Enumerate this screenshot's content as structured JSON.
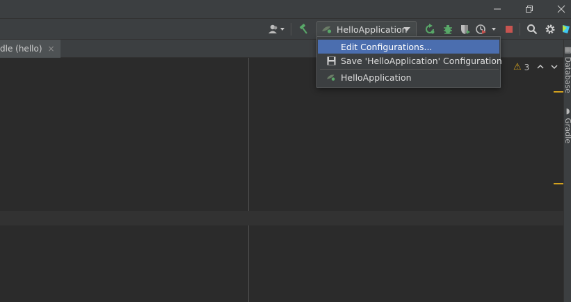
{
  "titlebar": {
    "icons": [
      "minimize-icon",
      "restore-icon",
      "close-icon"
    ]
  },
  "toolbar": {
    "run_config_label": "HelloApplication",
    "icons": [
      "user-dropdown-icon",
      "build-hammer-icon",
      "run-config-icon",
      "rerun-icon",
      "debug-bug-icon",
      "coverage-icon",
      "profiler-icon",
      "stop-icon",
      "search-icon",
      "settings-gear-icon",
      "jetbrains-logo-icon"
    ]
  },
  "tab": {
    "label": "dle (hello)",
    "close_glyph": "×"
  },
  "editor": {
    "warning_count": "3",
    "warning_glyph": "⚠"
  },
  "right_strip": {
    "database_label": "Database",
    "gradle_label": "Gradle"
  },
  "dropdown": {
    "items": [
      {
        "label": "Edit Configurations...",
        "icon": "none",
        "selected": true
      },
      {
        "label": "Save 'HelloApplication' Configuration",
        "icon": "save-floppy-icon",
        "selected": false
      },
      {
        "label": "HelloApplication",
        "icon": "run-config-icon",
        "selected": false
      }
    ]
  },
  "colors": {
    "background": "#2b2b2b",
    "panel": "#3c3f41",
    "selection": "#4b6eaf",
    "warning": "#d2a11e",
    "run_green": "#59a869",
    "stop_red": "#c75450"
  }
}
